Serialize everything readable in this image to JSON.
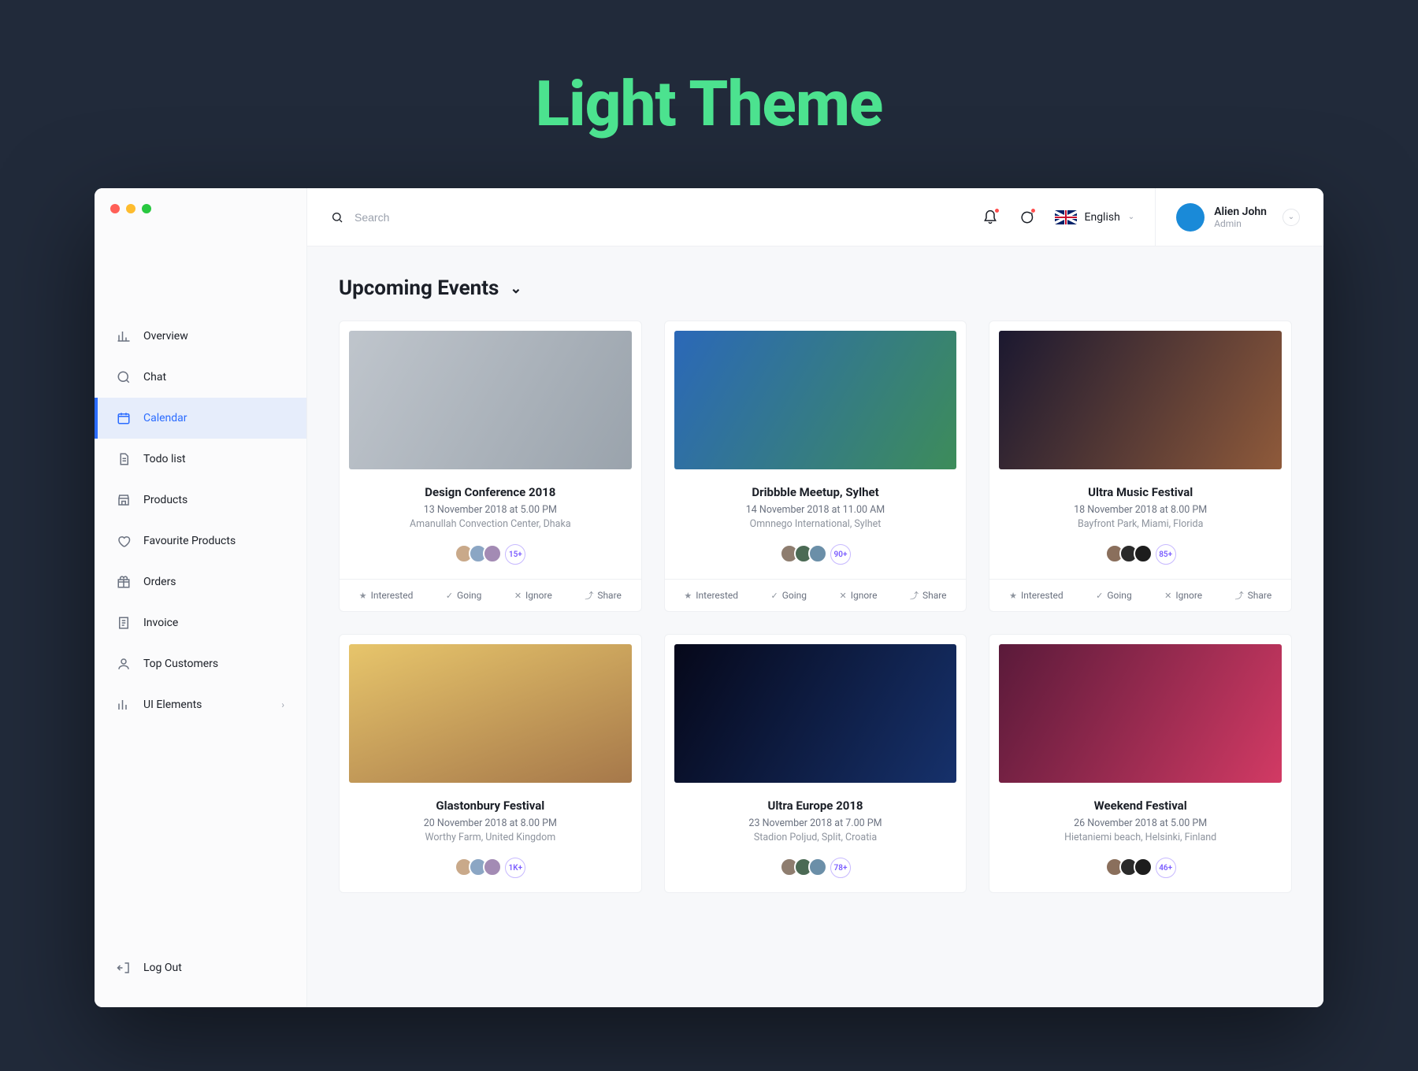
{
  "hero": "Light Theme",
  "search": {
    "placeholder": "Search"
  },
  "topbar": {
    "language": "English",
    "user_name": "Alien John",
    "user_role": "Admin"
  },
  "sidebar": {
    "items": [
      {
        "label": "Overview"
      },
      {
        "label": "Chat"
      },
      {
        "label": "Calendar"
      },
      {
        "label": "Todo list"
      },
      {
        "label": "Products"
      },
      {
        "label": "Favourite Products"
      },
      {
        "label": "Orders"
      },
      {
        "label": "Invoice"
      },
      {
        "label": "Top Customers"
      },
      {
        "label": "UI Elements"
      }
    ],
    "logout": "Log Out"
  },
  "page_title": "Upcoming Events",
  "actions": {
    "interested": "Interested",
    "going": "Going",
    "ignore": "Ignore",
    "share": "Share"
  },
  "events": [
    {
      "title": "Design Conference 2018",
      "date": "13 November 2018 at 5.00 PM",
      "location": "Amanullah Convection Center, Dhaka",
      "more": "15+"
    },
    {
      "title": "Dribbble Meetup, Sylhet",
      "date": "14 November 2018 at 11.00 AM",
      "location": "Omnnego International, Sylhet",
      "more": "90+"
    },
    {
      "title": "Ultra Music Festival",
      "date": "18 November 2018 at 8.00 PM",
      "location": "Bayfront Park, Miami, Florida",
      "more": "85+"
    },
    {
      "title": "Glastonbury Festival",
      "date": "20 November 2018 at 8.00 PM",
      "location": "Worthy Farm, United Kingdom",
      "more": "1K+"
    },
    {
      "title": "Ultra Europe 2018",
      "date": "23 November 2018 at 7.00 PM",
      "location": "Stadion Poljud, Split, Croatia",
      "more": "78+"
    },
    {
      "title": "Weekend Festival",
      "date": "26 November 2018 at 5.00 PM",
      "location": "Hietaniemi beach, Helsinki, Finland",
      "more": "46+"
    }
  ]
}
